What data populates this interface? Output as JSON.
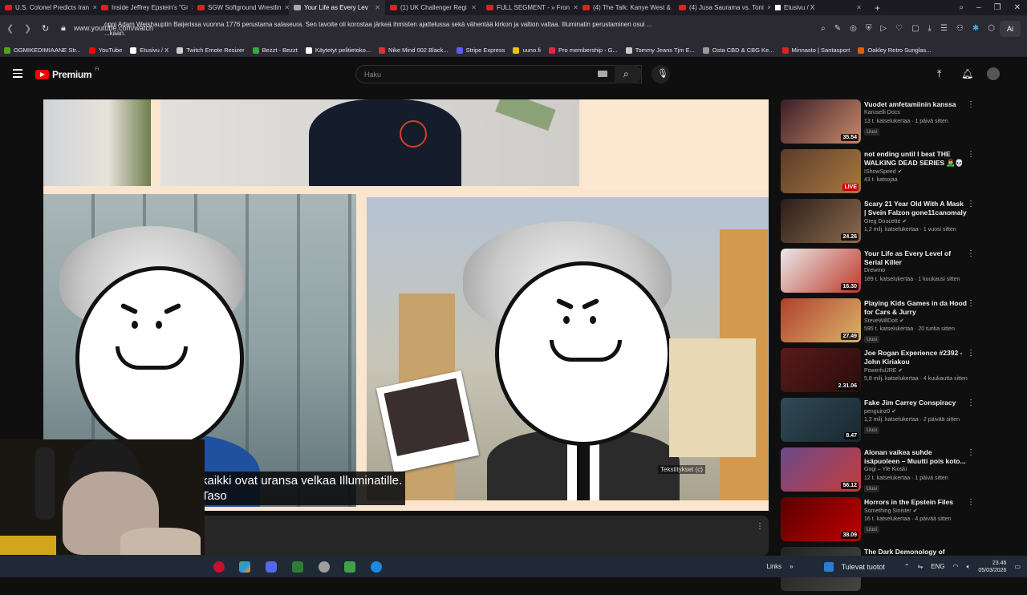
{
  "browser": {
    "tabs": [
      {
        "label": "U.S. Colonel Predicts Iran",
        "active": false
      },
      {
        "label": "Inside Jeffrey Epstein's \"Gi",
        "active": false
      },
      {
        "label": "SGW Softground Wrestlin",
        "active": false
      },
      {
        "label": "Your Life as Every Lev",
        "active": true
      },
      {
        "label": "(1) UK Challenger Regi",
        "active": false
      },
      {
        "label": "FULL SEGMENT - » Fron",
        "active": false
      },
      {
        "label": "(4) The Talk: Kanye West &",
        "active": false
      },
      {
        "label": "(4) Jusa Saurama vs. Toni",
        "active": false
      },
      {
        "label": "Etusivu / X",
        "active": false
      }
    ],
    "url": "www.youtube.com/watch",
    "ai_label": "Ai",
    "bookmarks": [
      {
        "label": "OGMIKEDIMIAANE Str...",
        "color": "#53a318"
      },
      {
        "label": "YouTube",
        "color": "#ff0000"
      },
      {
        "label": "Etusivu / X",
        "color": "#ffffff"
      },
      {
        "label": "Twitch Emote Resizer",
        "color": "#cccccc"
      },
      {
        "label": "Bezzt - Bezzt",
        "color": "#38a83a"
      },
      {
        "label": "Käytetyt pelitietoko...",
        "color": "#ffffff"
      },
      {
        "label": "Nike Mind 002 Black...",
        "color": "#d33"
      },
      {
        "label": "Stripe Express",
        "color": "#635bff"
      },
      {
        "label": "uuno.fi",
        "color": "#f0c000"
      },
      {
        "label": "Pro membership - G...",
        "color": "#e24"
      },
      {
        "label": "Tommy Jeans Tjm E...",
        "color": "#ccc"
      },
      {
        "label": "Osta CBD & CBG Ke...",
        "color": "#999"
      },
      {
        "label": "Minnasto | Santasport",
        "color": "#d22"
      },
      {
        "label": "Oakley Retro Sunglas...",
        "color": "#e85a00"
      }
    ]
  },
  "youtube": {
    "logo_text": "Premium",
    "logo_sup": "FI",
    "search_placeholder": "Haku"
  },
  "video": {
    "subtitle_line1": "kaikki ovat uransa velkaa Illuminatille.",
    "subtitle_line2": "Taso",
    "cc_label": "Tekstitykset (c)"
  },
  "description": {
    "text": "oppi Adam Weishauptin Baijerissa vuonna 1776 perustama salaseura. Sen tavoite oli korostaa järkeä ihmisten ajattelussa sekä vähentää kirkon ja valtion valtaa. Illuminatin perustaminen osui ...",
    "text2": "...kaan.",
    "more_icon": "more-vert-icon"
  },
  "recommendations": [
    {
      "title": "Vuodet amfetamiinin kanssa",
      "channel": "Karuselli Docs",
      "meta": "13 t. katselukertaa · 1 päivä sitten",
      "badge": "Uusi",
      "duration": "35.54",
      "colors": [
        "#3a1e28",
        "#c98a6a"
      ]
    },
    {
      "title": "not ending until I beat THE WALKING DEAD SERIES 🧟‍♂️💀",
      "channel": "IShowSpeed ✔",
      "meta": "43 t. katsojaa",
      "badge": "",
      "duration": "LIVE",
      "colors": [
        "#5b3a2a",
        "#a87a40"
      ]
    },
    {
      "title": "Scary 21 Year Old With A Mask | Svein Falzon gone11canomaly",
      "channel": "Greg Doucette ✔",
      "meta": "1,2 milj. katselukertaa · 1 vuosi sitten",
      "badge": "",
      "duration": "24.26",
      "colors": [
        "#2a1d18",
        "#8d6b50"
      ]
    },
    {
      "title": "Your Life as Every Level of Serial Killer",
      "channel": "Drewmo",
      "meta": "189 t. katselukertaa · 1 kuukausi sitten",
      "badge": "",
      "duration": "16.30",
      "colors": [
        "#e9e9e9",
        "#c0392b"
      ]
    },
    {
      "title": "Playing Kids Games in da Hood for Cars & Jurry",
      "channel": "SteveWillDoIt ✔",
      "meta": "595 t. katselukertaa · 20 tuntia sitten",
      "badge": "Uusi",
      "duration": "27.49",
      "colors": [
        "#b1412c",
        "#d9b36b"
      ]
    },
    {
      "title": "Joe Rogan Experience #2392 - John Kiriakou",
      "channel": "PowerfulJRE ✔",
      "meta": "5,8 milj. katselukertaa · 4 kuukautta sitten",
      "badge": "",
      "duration": "2.31.06",
      "colors": [
        "#5a1a1a",
        "#2a0c0c"
      ]
    },
    {
      "title": "Fake Jim Carrey Conspiracy",
      "channel": "penguinz0 ✔",
      "meta": "1,2 milj. katselukertaa · 2 päivää sitten",
      "badge": "Uusi",
      "duration": "8.47",
      "colors": [
        "#2f4a55",
        "#1a2730"
      ]
    },
    {
      "title": "Alonan vaikea suhde isäpuoleen – Muutti pois koto...",
      "channel": "Gogi – Yle Kioski",
      "meta": "12 t. katselukertaa · 1 päivä sitten",
      "badge": "Uusi",
      "duration": "56.12",
      "colors": [
        "#6b4a8a",
        "#c43c3c"
      ]
    },
    {
      "title": "Horrors in the Epstein Files",
      "channel": "Something Sinister ✔",
      "meta": "16 t. katselukertaa · 4 päivää sitten",
      "badge": "Uusi",
      "duration": "38.09",
      "colors": [
        "#5a0000",
        "#c00000"
      ]
    },
    {
      "title": "The Dark Demonology of",
      "channel": "",
      "meta": "",
      "badge": "",
      "duration": "",
      "colors": [
        "#222",
        "#444"
      ]
    }
  ],
  "taskbar": {
    "links_label": "Links",
    "weather": "Tulevat tuotot",
    "lang": "ENG",
    "time": "23.46",
    "date": "05/03/2026"
  }
}
